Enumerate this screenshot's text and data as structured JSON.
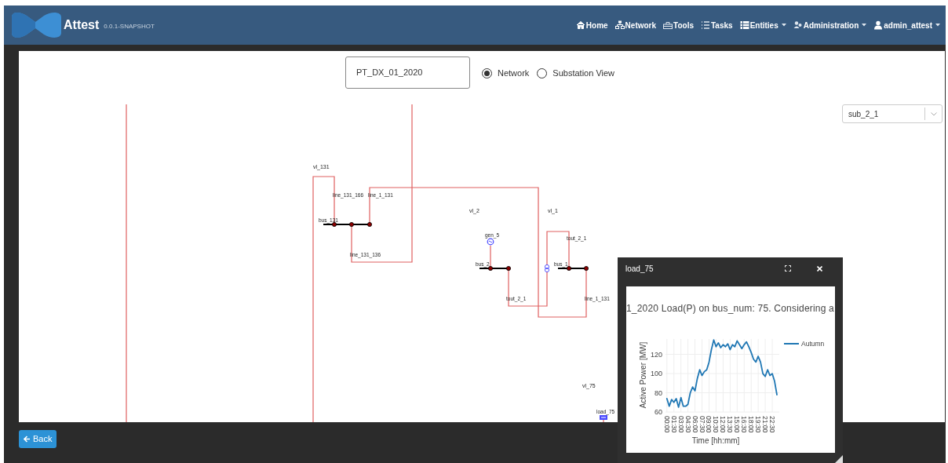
{
  "app": {
    "name": "Attest",
    "version": "0.0.1-SNAPSHOT"
  },
  "nav": [
    {
      "label": "Home",
      "caret": false
    },
    {
      "label": "Network",
      "caret": false
    },
    {
      "label": "Tools",
      "caret": false
    },
    {
      "label": "Tasks",
      "caret": false
    },
    {
      "label": "Entities",
      "caret": true
    },
    {
      "label": "Administration",
      "caret": true
    },
    {
      "label": "admin_attest",
      "caret": true
    }
  ],
  "network_field": {
    "value": "PT_DX_01_2020"
  },
  "view_options": [
    {
      "label": "Network",
      "selected": true
    },
    {
      "label": "Substation View",
      "selected": false
    }
  ],
  "substation_select": {
    "value": "sub_2_1"
  },
  "diagram": {
    "labels": [
      "vl_131",
      "line_131_166",
      "line_1_131",
      "bus_131",
      "line_131_136",
      "vl_2",
      "vl_1",
      "gen_5",
      "bus_2",
      "bus_1",
      "tout_2_1",
      "tout_2_1",
      "line_1_131",
      "vl_75",
      "load_75"
    ]
  },
  "popup": {
    "title": "load_75",
    "description": "1_2020 Load(P) on bus_num: 75. Considering  a",
    "chart_data": {
      "type": "line",
      "xlabel": "Time [hh:mm]",
      "ylabel": "Active Power [MW]",
      "x": [
        0,
        0.5,
        1,
        1.5,
        2,
        2.5,
        3,
        3.5,
        4,
        4.5,
        5,
        5.5,
        6,
        6.5,
        7,
        7.5,
        8,
        8.5,
        9,
        9.5,
        10,
        10.5,
        11,
        11.5,
        12,
        12.5,
        13,
        13.5,
        14,
        14.5,
        15,
        15.5,
        16,
        16.5,
        17,
        17.5,
        18,
        18.5,
        19,
        19.5,
        20,
        20.5,
        21,
        21.5,
        22,
        22.5,
        23,
        23.5
      ],
      "series": [
        {
          "name": "Autumn",
          "color": "#1f77b4",
          "values": [
            74,
            66,
            73,
            70,
            74,
            65,
            75,
            66,
            66,
            68,
            80,
            86,
            82,
            95,
            104,
            98,
            102,
            104,
            112,
            125,
            135,
            128,
            132,
            127,
            130,
            128,
            131,
            125,
            130,
            128,
            134,
            130,
            126,
            130,
            133,
            128,
            122,
            115,
            112,
            118,
            112,
            100,
            97,
            104,
            98,
            100,
            92,
            78
          ]
        }
      ],
      "grid": true,
      "xlim": [
        -0.3,
        24
      ],
      "ylim": [
        60,
        136
      ],
      "yticks": [
        60,
        80,
        100,
        120
      ],
      "xticks": [
        {
          "value": 0,
          "label": "00:00"
        },
        {
          "value": 1.5,
          "label": "01:30"
        },
        {
          "value": 3,
          "label": "03:00"
        },
        {
          "value": 4.5,
          "label": "04:30"
        },
        {
          "value": 6,
          "label": "06:00"
        },
        {
          "value": 7.5,
          "label": "07:30"
        },
        {
          "value": 9,
          "label": "09:00"
        },
        {
          "value": 10.5,
          "label": "10:30"
        },
        {
          "value": 12,
          "label": "12:00"
        },
        {
          "value": 13.5,
          "label": "13:30"
        },
        {
          "value": 15,
          "label": "15:00"
        },
        {
          "value": 16.5,
          "label": "16:30"
        },
        {
          "value": 18,
          "label": "18:00"
        },
        {
          "value": 19.5,
          "label": "19:30"
        },
        {
          "value": 21,
          "label": "21:00"
        },
        {
          "value": 22.5,
          "label": "22:30"
        }
      ]
    }
  },
  "back_button": {
    "label": "Back"
  }
}
